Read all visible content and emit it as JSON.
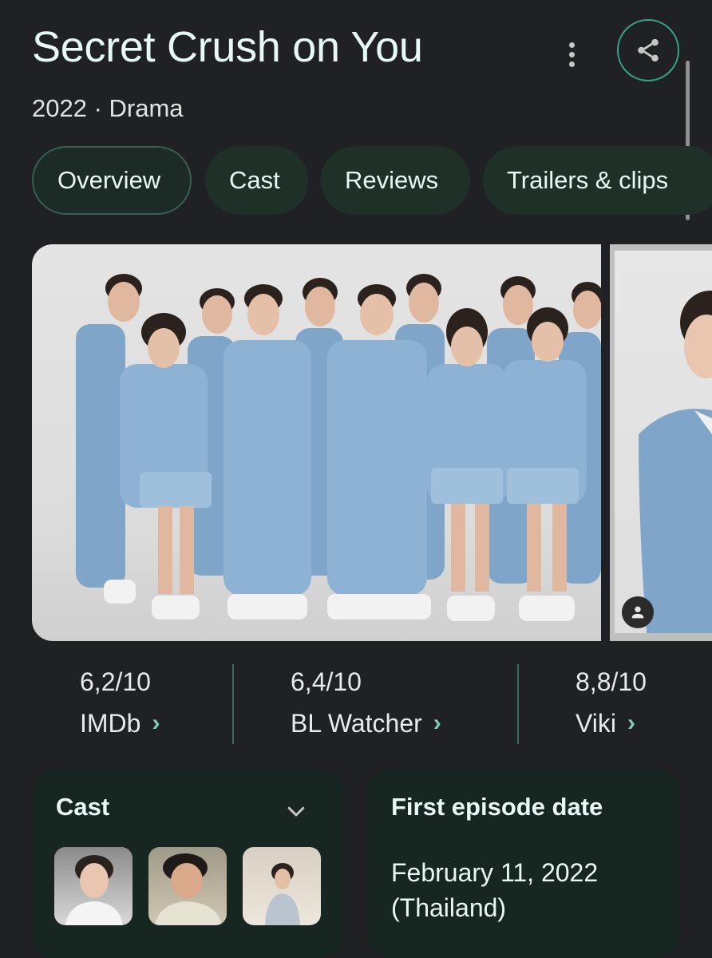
{
  "header": {
    "title": "Secret Crush on You",
    "subtitle": "2022 · Drama",
    "more_icon": "more-vert-icon",
    "share_icon": "share-icon"
  },
  "tabs": [
    {
      "label": "Overview",
      "active": true
    },
    {
      "label": "Cast",
      "active": false
    },
    {
      "label": "Reviews",
      "active": false
    },
    {
      "label": "Trailers & clips",
      "active": false
    }
  ],
  "gallery": {
    "person_icon": "person-icon"
  },
  "ratings": [
    {
      "score": "6,2/10",
      "source": "IMDb"
    },
    {
      "score": "6,4/10",
      "source": "BL Watcher"
    },
    {
      "score": "8,8/10",
      "source": "Viki"
    }
  ],
  "cast_card": {
    "title": "Cast",
    "expand_icon": "chevron-down-icon"
  },
  "first_episode": {
    "title": "First episode date",
    "date": "February 11, 2022",
    "country": "(Thailand)"
  },
  "colors": {
    "background": "#202124",
    "accent": "#34a58b",
    "chip": "#1f3029",
    "card": "#182621",
    "uniform": "#7fa6c9"
  }
}
